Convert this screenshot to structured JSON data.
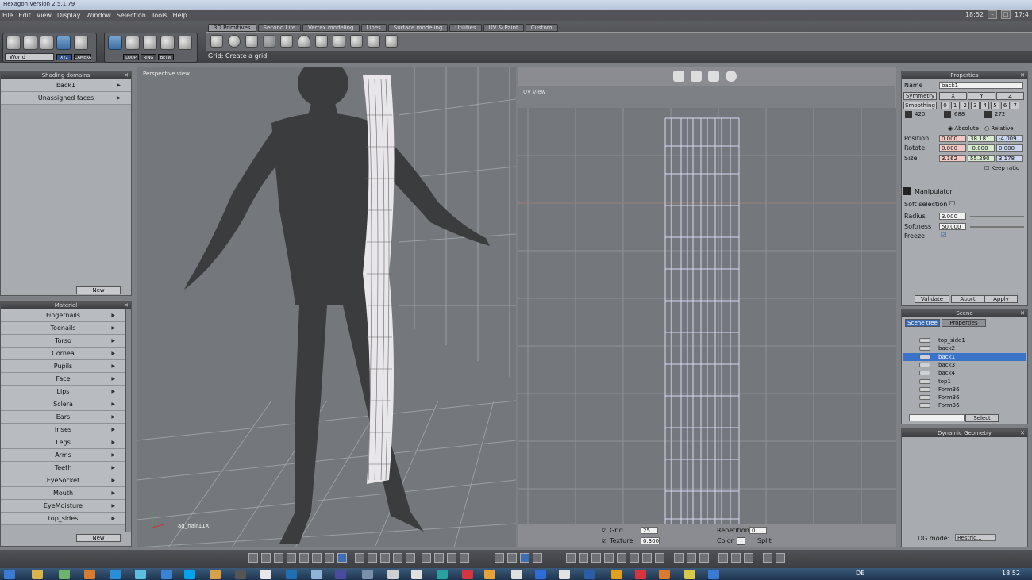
{
  "window": {
    "title": "Hexagon Version 2.5.1.79",
    "clock": "18:52",
    "clock_right": "17:4"
  },
  "menu": [
    "File",
    "Edit",
    "View",
    "Display",
    "Window",
    "Selection",
    "Tools",
    "Help"
  ],
  "toolbar": {
    "world_select": "World",
    "xyz_btn": "XYZ",
    "camera_btn": "CAMERA",
    "loop_btn": "LOOP",
    "ring_btn": "RING",
    "betw_btn": "BETW",
    "tabs": [
      "3D Primitives",
      "Second Life",
      "Vertex modeling",
      "Lines",
      "Surface modeling",
      "Utilities",
      "UV & Paint",
      "Custom"
    ],
    "active_tab": 0,
    "hint": "Grid: Create a grid"
  },
  "shading": {
    "title": "Shading domains",
    "items": [
      "back1",
      "Unassigned faces"
    ],
    "new_btn": "New"
  },
  "material": {
    "title": "Material",
    "items": [
      "Fingernails",
      "Toenails",
      "Torso",
      "Cornea",
      "Pupils",
      "Face",
      "Lips",
      "Sclera",
      "Ears",
      "Irises",
      "Legs",
      "Arms",
      "Teeth",
      "EyeSocket",
      "Mouth",
      "EyeMoisture",
      "top_sides"
    ],
    "new_btn": "New"
  },
  "viewport": {
    "label": "Perspective view",
    "object_label": "ag_hair11X"
  },
  "uv": {
    "label": "UV view",
    "grid_label": "Grid",
    "grid_value": "25",
    "texture_label": "Texture",
    "texture_value": "0.300",
    "repetition_label": "Repetition",
    "repetition_value": "0",
    "color_label": "Color",
    "split_label": "Split"
  },
  "properties": {
    "title": "Properties",
    "name_label": "Name",
    "name_value": "back1",
    "symmetry_label": "Symmetry",
    "axes": [
      "X",
      "Y",
      "Z"
    ],
    "smoothing_label": "Smoothing",
    "smoothing_levels": [
      "0",
      "1",
      "2",
      "3",
      "4",
      "5",
      "6",
      "7"
    ],
    "counts": [
      "420",
      "688",
      "272"
    ],
    "absolute": "Absolute",
    "relative": "Relative",
    "position_label": "Position",
    "position": [
      "0.000",
      "38.181",
      "-4.009"
    ],
    "rotate_label": "Rotate",
    "rotate": [
      "0.000",
      "-0.000",
      "0.000"
    ],
    "size_label": "Size",
    "size": [
      "3.162",
      "55.290",
      "3.178"
    ],
    "keep_ratio": "Keep ratio",
    "manipulator": "Manipulator",
    "soft_selection": "Soft selection",
    "radius_label": "Radius",
    "radius": "3.000",
    "softness_label": "Softness",
    "softness": "50.000",
    "freeze_label": "Freeze",
    "validate": "Validate",
    "abort": "Abort",
    "apply": "Apply"
  },
  "scene": {
    "title": "Scene",
    "tabs": [
      "Scene tree",
      "Properties"
    ],
    "items": [
      "top_side1",
      "back2",
      "back1",
      "back3",
      "back4",
      "top1",
      "Form36",
      "Form36",
      "Form36"
    ],
    "selected": 2,
    "select_btn": "Select"
  },
  "dynamic": {
    "title": "Dynamic Geometry",
    "mode_label": "DG mode:",
    "mode_value": "Restric..."
  },
  "taskbar": {
    "lang": "DE",
    "clock": "18:52"
  }
}
